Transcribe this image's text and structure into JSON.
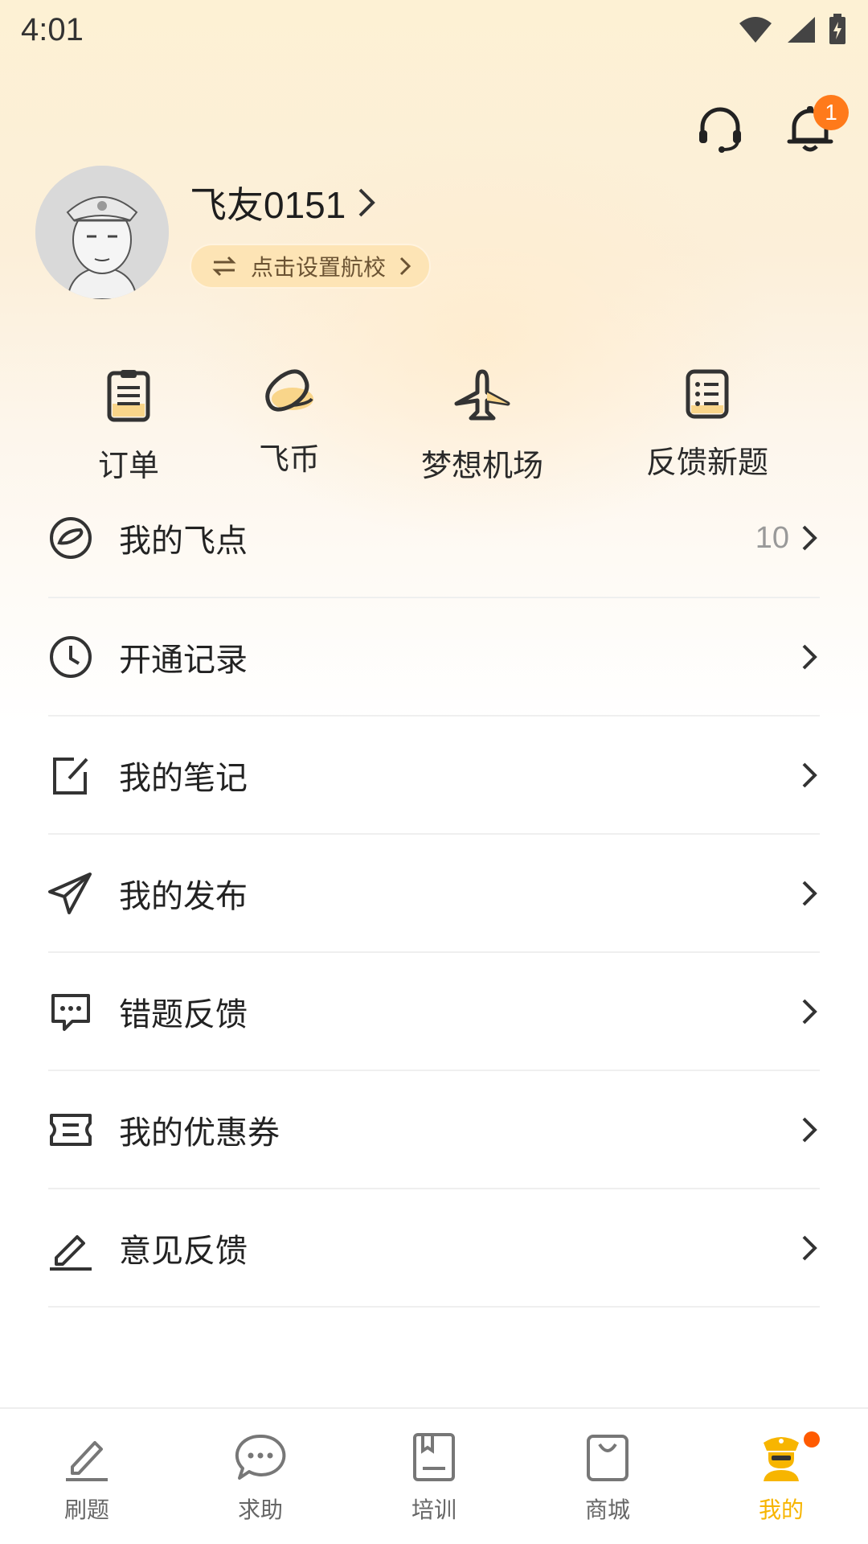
{
  "status_bar": {
    "time": "4:01"
  },
  "header": {
    "notification_count": "1"
  },
  "profile": {
    "username": "飞友0151",
    "school_prompt": "点击设置航校"
  },
  "quick_actions": [
    {
      "label": "订单",
      "icon": "order-clipboard-icon"
    },
    {
      "label": "飞币",
      "icon": "flight-coin-icon"
    },
    {
      "label": "梦想机场",
      "icon": "airplane-icon"
    },
    {
      "label": "反馈新题",
      "icon": "feedback-list-icon"
    }
  ],
  "menu": [
    {
      "label": "我的飞点",
      "value": "10",
      "icon": "flight-points-icon"
    },
    {
      "label": "开通记录",
      "value": "",
      "icon": "clock-icon"
    },
    {
      "label": "我的笔记",
      "value": "",
      "icon": "note-edit-icon"
    },
    {
      "label": "我的发布",
      "value": "",
      "icon": "paper-plane-icon"
    },
    {
      "label": "错题反馈",
      "value": "",
      "icon": "chat-bubble-icon"
    },
    {
      "label": "我的优惠券",
      "value": "",
      "icon": "coupon-icon"
    },
    {
      "label": "意见反馈",
      "value": "",
      "icon": "pen-icon"
    }
  ],
  "tabbar": [
    {
      "label": "刷题",
      "icon": "pen-underline-icon",
      "active": false
    },
    {
      "label": "求助",
      "icon": "chat-dots-icon",
      "active": false
    },
    {
      "label": "培训",
      "icon": "book-icon",
      "active": false
    },
    {
      "label": "商城",
      "icon": "shopping-bag-icon",
      "active": false
    },
    {
      "label": "我的",
      "icon": "pilot-avatar-icon",
      "active": true
    }
  ],
  "colors": {
    "accent": "#f7b500",
    "badge": "#ff7a1a",
    "dot": "#ff5a00"
  }
}
